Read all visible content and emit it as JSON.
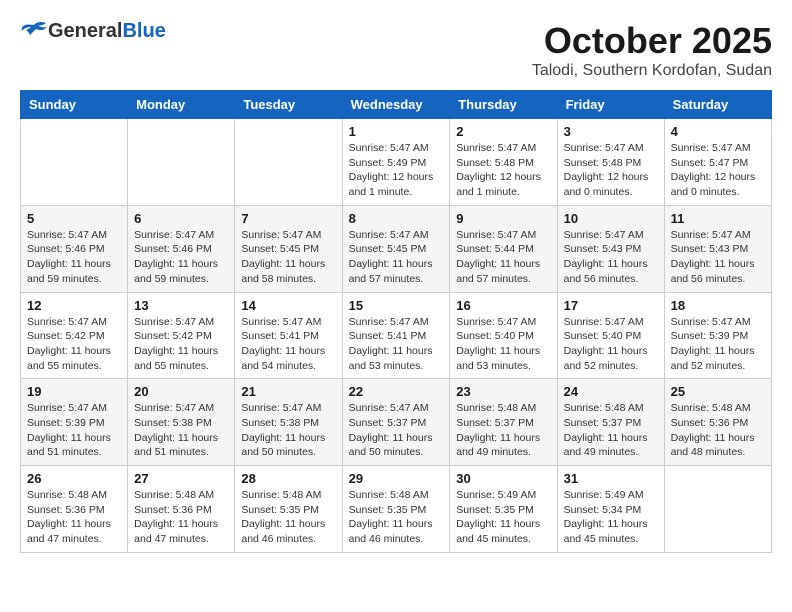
{
  "header": {
    "logo_general": "General",
    "logo_blue": "Blue",
    "month_title": "October 2025",
    "location": "Talodi, Southern Kordofan, Sudan"
  },
  "days_of_week": [
    "Sunday",
    "Monday",
    "Tuesday",
    "Wednesday",
    "Thursday",
    "Friday",
    "Saturday"
  ],
  "weeks": [
    [
      {
        "day": "",
        "info": ""
      },
      {
        "day": "",
        "info": ""
      },
      {
        "day": "",
        "info": ""
      },
      {
        "day": "1",
        "info": "Sunrise: 5:47 AM\nSunset: 5:49 PM\nDaylight: 12 hours\nand 1 minute."
      },
      {
        "day": "2",
        "info": "Sunrise: 5:47 AM\nSunset: 5:48 PM\nDaylight: 12 hours\nand 1 minute."
      },
      {
        "day": "3",
        "info": "Sunrise: 5:47 AM\nSunset: 5:48 PM\nDaylight: 12 hours\nand 0 minutes."
      },
      {
        "day": "4",
        "info": "Sunrise: 5:47 AM\nSunset: 5:47 PM\nDaylight: 12 hours\nand 0 minutes."
      }
    ],
    [
      {
        "day": "5",
        "info": "Sunrise: 5:47 AM\nSunset: 5:46 PM\nDaylight: 11 hours\nand 59 minutes."
      },
      {
        "day": "6",
        "info": "Sunrise: 5:47 AM\nSunset: 5:46 PM\nDaylight: 11 hours\nand 59 minutes."
      },
      {
        "day": "7",
        "info": "Sunrise: 5:47 AM\nSunset: 5:45 PM\nDaylight: 11 hours\nand 58 minutes."
      },
      {
        "day": "8",
        "info": "Sunrise: 5:47 AM\nSunset: 5:45 PM\nDaylight: 11 hours\nand 57 minutes."
      },
      {
        "day": "9",
        "info": "Sunrise: 5:47 AM\nSunset: 5:44 PM\nDaylight: 11 hours\nand 57 minutes."
      },
      {
        "day": "10",
        "info": "Sunrise: 5:47 AM\nSunset: 5:43 PM\nDaylight: 11 hours\nand 56 minutes."
      },
      {
        "day": "11",
        "info": "Sunrise: 5:47 AM\nSunset: 5:43 PM\nDaylight: 11 hours\nand 56 minutes."
      }
    ],
    [
      {
        "day": "12",
        "info": "Sunrise: 5:47 AM\nSunset: 5:42 PM\nDaylight: 11 hours\nand 55 minutes."
      },
      {
        "day": "13",
        "info": "Sunrise: 5:47 AM\nSunset: 5:42 PM\nDaylight: 11 hours\nand 55 minutes."
      },
      {
        "day": "14",
        "info": "Sunrise: 5:47 AM\nSunset: 5:41 PM\nDaylight: 11 hours\nand 54 minutes."
      },
      {
        "day": "15",
        "info": "Sunrise: 5:47 AM\nSunset: 5:41 PM\nDaylight: 11 hours\nand 53 minutes."
      },
      {
        "day": "16",
        "info": "Sunrise: 5:47 AM\nSunset: 5:40 PM\nDaylight: 11 hours\nand 53 minutes."
      },
      {
        "day": "17",
        "info": "Sunrise: 5:47 AM\nSunset: 5:40 PM\nDaylight: 11 hours\nand 52 minutes."
      },
      {
        "day": "18",
        "info": "Sunrise: 5:47 AM\nSunset: 5:39 PM\nDaylight: 11 hours\nand 52 minutes."
      }
    ],
    [
      {
        "day": "19",
        "info": "Sunrise: 5:47 AM\nSunset: 5:39 PM\nDaylight: 11 hours\nand 51 minutes."
      },
      {
        "day": "20",
        "info": "Sunrise: 5:47 AM\nSunset: 5:38 PM\nDaylight: 11 hours\nand 51 minutes."
      },
      {
        "day": "21",
        "info": "Sunrise: 5:47 AM\nSunset: 5:38 PM\nDaylight: 11 hours\nand 50 minutes."
      },
      {
        "day": "22",
        "info": "Sunrise: 5:47 AM\nSunset: 5:37 PM\nDaylight: 11 hours\nand 50 minutes."
      },
      {
        "day": "23",
        "info": "Sunrise: 5:48 AM\nSunset: 5:37 PM\nDaylight: 11 hours\nand 49 minutes."
      },
      {
        "day": "24",
        "info": "Sunrise: 5:48 AM\nSunset: 5:37 PM\nDaylight: 11 hours\nand 49 minutes."
      },
      {
        "day": "25",
        "info": "Sunrise: 5:48 AM\nSunset: 5:36 PM\nDaylight: 11 hours\nand 48 minutes."
      }
    ],
    [
      {
        "day": "26",
        "info": "Sunrise: 5:48 AM\nSunset: 5:36 PM\nDaylight: 11 hours\nand 47 minutes."
      },
      {
        "day": "27",
        "info": "Sunrise: 5:48 AM\nSunset: 5:36 PM\nDaylight: 11 hours\nand 47 minutes."
      },
      {
        "day": "28",
        "info": "Sunrise: 5:48 AM\nSunset: 5:35 PM\nDaylight: 11 hours\nand 46 minutes."
      },
      {
        "day": "29",
        "info": "Sunrise: 5:48 AM\nSunset: 5:35 PM\nDaylight: 11 hours\nand 46 minutes."
      },
      {
        "day": "30",
        "info": "Sunrise: 5:49 AM\nSunset: 5:35 PM\nDaylight: 11 hours\nand 45 minutes."
      },
      {
        "day": "31",
        "info": "Sunrise: 5:49 AM\nSunset: 5:34 PM\nDaylight: 11 hours\nand 45 minutes."
      },
      {
        "day": "",
        "info": ""
      }
    ]
  ]
}
